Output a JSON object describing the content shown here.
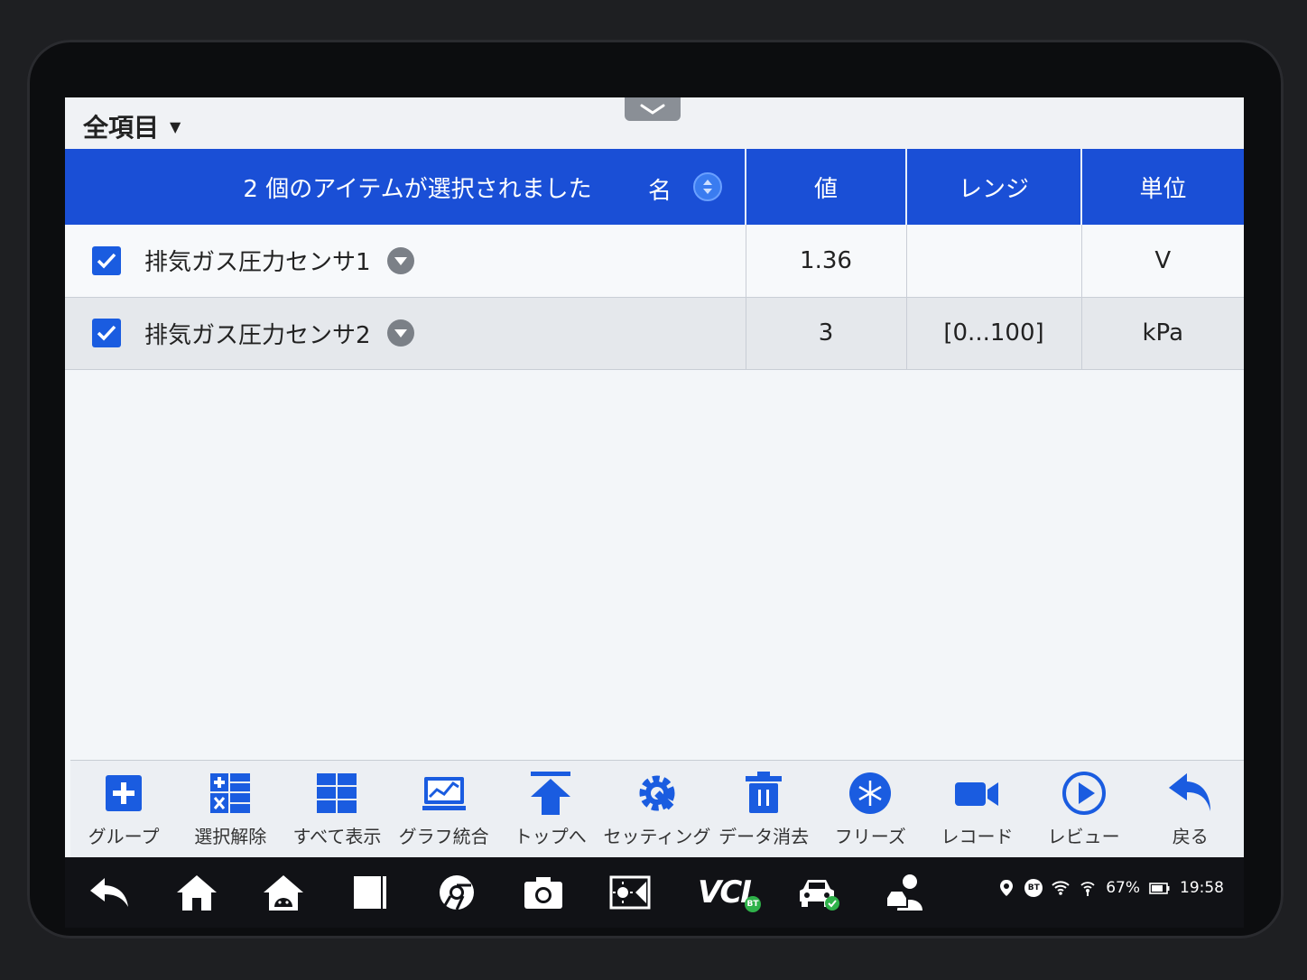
{
  "header": {
    "filter_label": "全項目"
  },
  "table": {
    "selection_text": "2 個のアイテムが選択されました",
    "columns": {
      "name": "名",
      "value": "値",
      "range": "レンジ",
      "unit": "単位"
    },
    "rows": [
      {
        "checked": true,
        "name": "排気ガス圧力センサ1",
        "value": "1.36",
        "range": "",
        "unit": "V"
      },
      {
        "checked": true,
        "name": "排気ガス圧力センサ2",
        "value": "3",
        "range": "[0...100]",
        "unit": "kPa"
      }
    ]
  },
  "toolbar": {
    "items": [
      {
        "label": "グループ",
        "icon": "plus-icon"
      },
      {
        "label": "選択解除",
        "icon": "calculator-grid-icon"
      },
      {
        "label": "すべて表示",
        "icon": "grid-icon"
      },
      {
        "label": "グラフ統合",
        "icon": "chart-icon"
      },
      {
        "label": "トップへ",
        "icon": "arrow-up-icon"
      },
      {
        "label": "セッティング",
        "icon": "gear-wrench-icon"
      },
      {
        "label": "データ消去",
        "icon": "trash-icon"
      },
      {
        "label": "フリーズ",
        "icon": "snowflake-icon"
      },
      {
        "label": "レコード",
        "icon": "video-camera-icon"
      },
      {
        "label": "レビュー",
        "icon": "play-icon"
      },
      {
        "label": "戻る",
        "icon": "undo-arrow-icon"
      }
    ]
  },
  "navbar": {
    "vci_label": "VCI",
    "vci_badge": "BT",
    "status": {
      "bt_badge": "BT",
      "battery": "67%",
      "time": "19:58"
    }
  },
  "colors": {
    "header_blue": "#1a4fd6",
    "icon_blue": "#1a5ce0",
    "row_alt": "#e5e8ec",
    "navbar": "#111216"
  }
}
